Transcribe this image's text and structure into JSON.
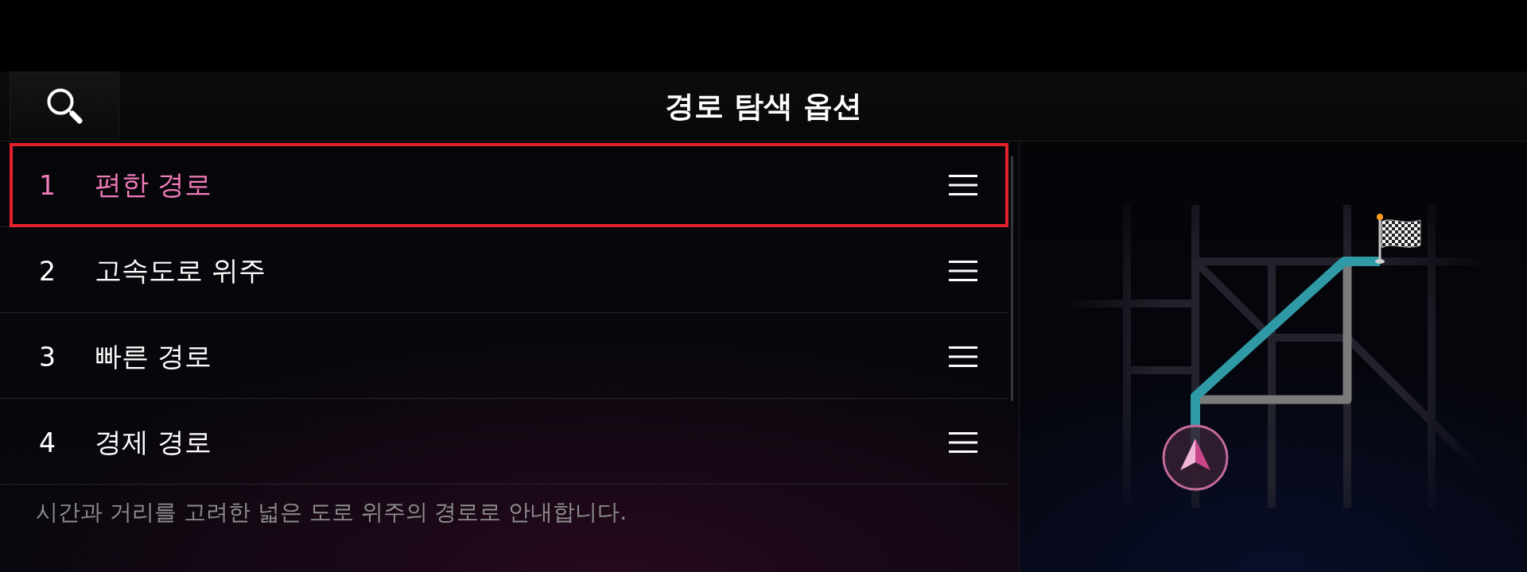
{
  "header": {
    "title": "경로 탐색 옵션"
  },
  "route_options": [
    {
      "number": "1",
      "label": "편한 경로",
      "selected": true
    },
    {
      "number": "2",
      "label": "고속도로 위주",
      "selected": false
    },
    {
      "number": "3",
      "label": "빠른 경로",
      "selected": false
    },
    {
      "number": "4",
      "label": "경제 경로",
      "selected": false
    }
  ],
  "description": "시간과 거리를 고려한 넓은 도로 위주의 경로로 안내합니다."
}
